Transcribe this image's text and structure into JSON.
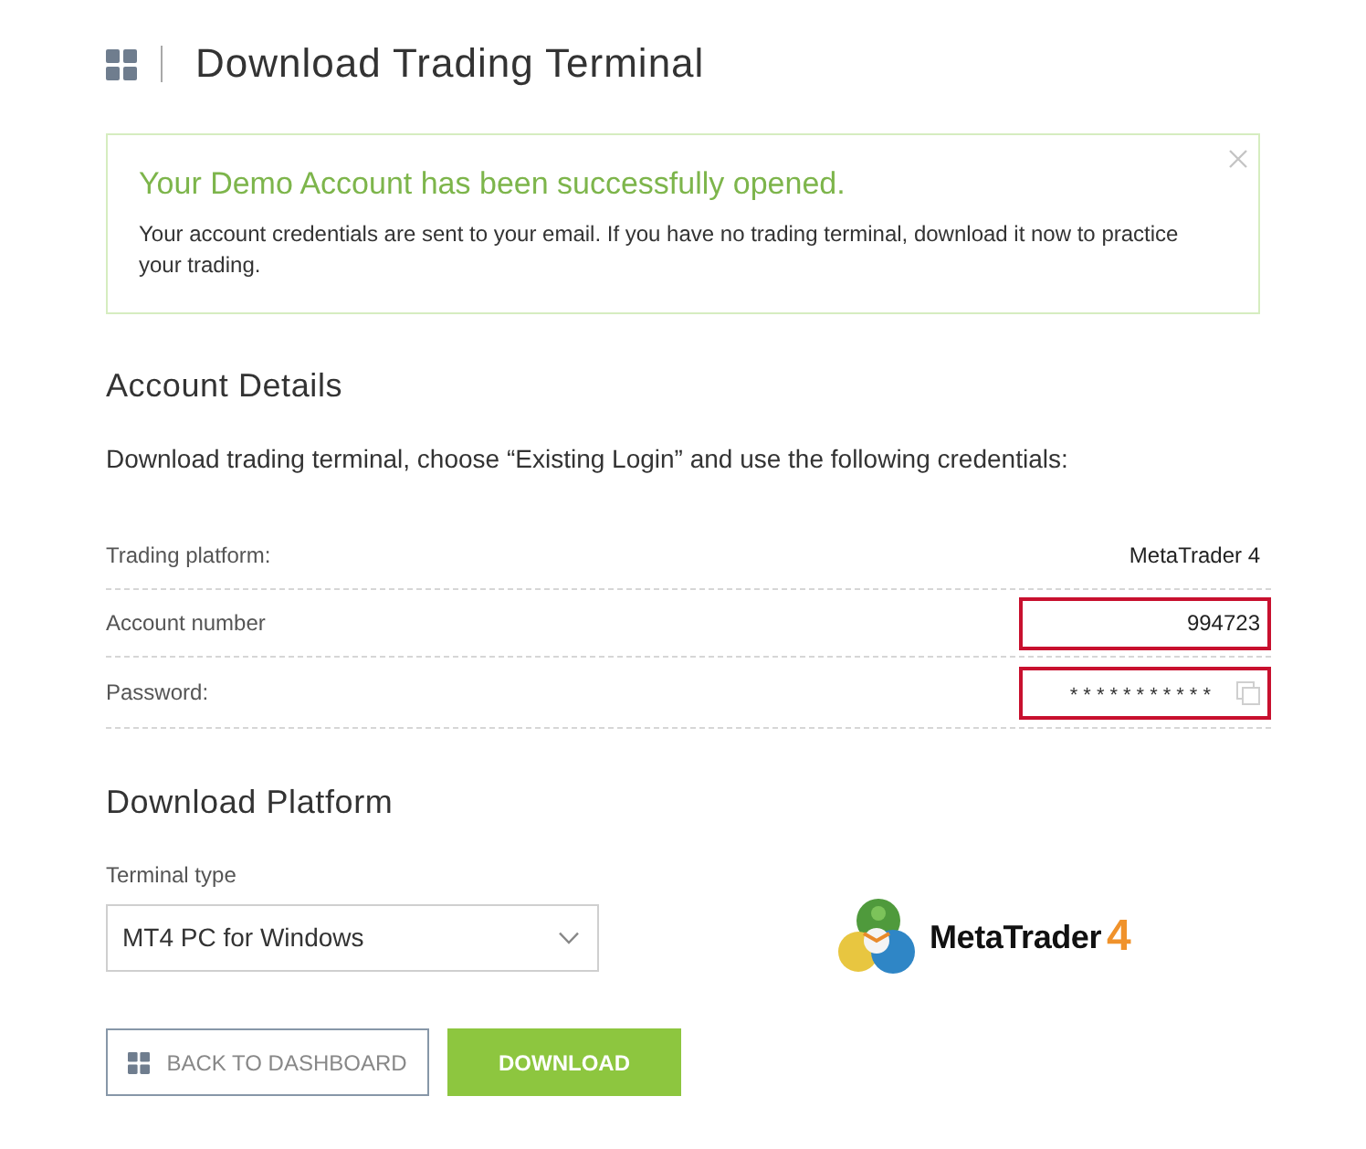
{
  "header": {
    "title": "Download Trading Terminal"
  },
  "alert": {
    "title": "Your Demo Account has been successfully opened.",
    "message": "Your account credentials are sent to your email. If you have no trading terminal, download it now to practice your trading.",
    "dismissible": true
  },
  "account_details": {
    "heading": "Account Details",
    "instruction": "Download trading terminal, choose “Existing Login” and use the following credentials:",
    "rows": [
      {
        "label": "Trading platform:",
        "value": "MetaTrader 4",
        "highlighted": false,
        "kind": "text"
      },
      {
        "label": "Account number",
        "value": "994723",
        "highlighted": true,
        "kind": "text"
      },
      {
        "label": "Password:",
        "value": "***********",
        "highlighted": true,
        "kind": "secret"
      }
    ]
  },
  "download_platform": {
    "heading": "Download Platform",
    "terminal_type": {
      "label": "Terminal type",
      "value": "MT4 PC for Windows"
    },
    "logo": {
      "name": "MetaTrader",
      "version": "4"
    }
  },
  "buttons": [
    {
      "label": "BACK TO DASHBOARD",
      "kind": "secondary"
    },
    {
      "label": "DOWNLOAD",
      "kind": "primary"
    }
  ]
}
